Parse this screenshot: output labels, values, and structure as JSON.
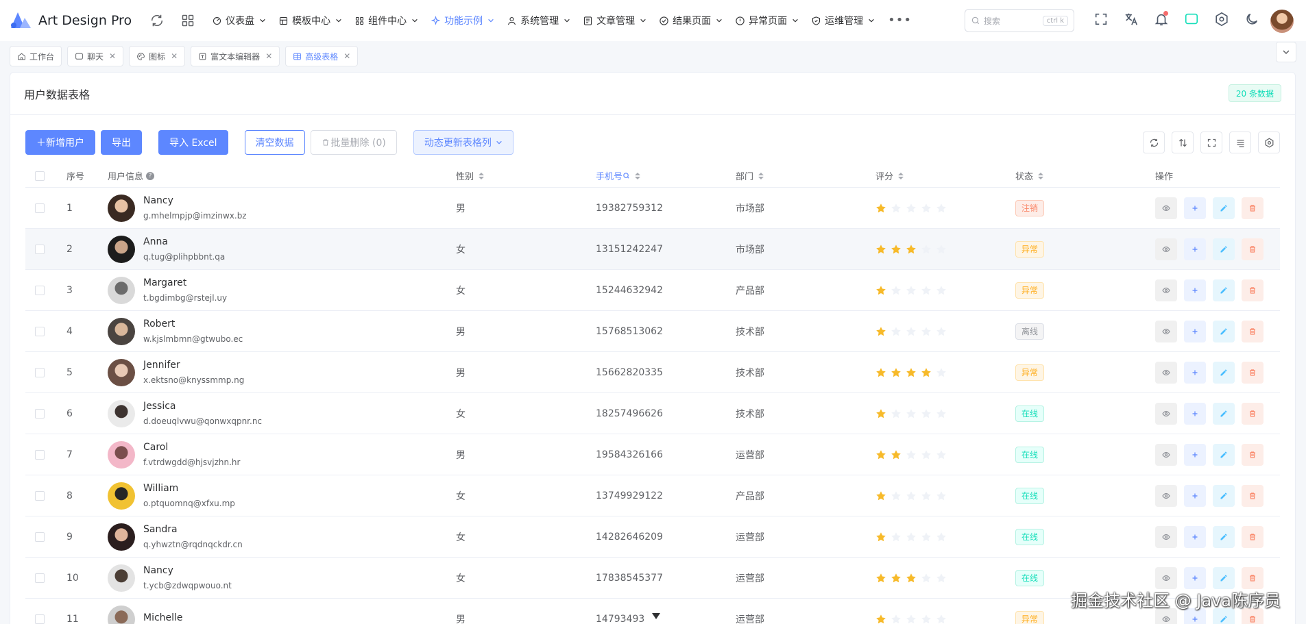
{
  "app": {
    "name": "Art Design Pro"
  },
  "menu": [
    {
      "label": "仪表盘",
      "icon": "dashboard-icon",
      "active": false
    },
    {
      "label": "模板中心",
      "icon": "template-icon",
      "active": false
    },
    {
      "label": "组件中心",
      "icon": "widgets-icon",
      "active": false
    },
    {
      "label": "功能示例",
      "icon": "sparkle-icon",
      "active": true
    },
    {
      "label": "系统管理",
      "icon": "user-icon",
      "active": false
    },
    {
      "label": "文章管理",
      "icon": "article-icon",
      "active": false
    },
    {
      "label": "结果页面",
      "icon": "check-circle-icon",
      "active": false
    },
    {
      "label": "异常页面",
      "icon": "warning-circle-icon",
      "active": false
    },
    {
      "label": "运维管理",
      "icon": "shield-icon",
      "active": false
    }
  ],
  "search": {
    "placeholder": "搜索",
    "shortcut": "ctrl k"
  },
  "tabs": [
    {
      "label": "工作台",
      "icon": "home-icon",
      "closable": false,
      "active": false
    },
    {
      "label": "聊天",
      "icon": "chat-icon",
      "closable": true,
      "active": false
    },
    {
      "label": "图标",
      "icon": "palette-icon",
      "closable": true,
      "active": false
    },
    {
      "label": "富文本编辑器",
      "icon": "editor-icon",
      "closable": true,
      "active": false
    },
    {
      "label": "高级表格",
      "icon": "table-icon",
      "closable": true,
      "active": true
    }
  ],
  "card": {
    "title": "用户数据表格",
    "count_badge": "20 条数据"
  },
  "toolbar": {
    "add_user": "＋新增用户",
    "export": "导出",
    "import_excel": "导入 Excel",
    "clear_data": "清空数据",
    "batch_delete": "批量删除 (0)",
    "dynamic_columns": "动态更新表格列"
  },
  "table": {
    "headers": {
      "index": "序号",
      "user": "用户信息",
      "gender": "性别",
      "phone": "手机号",
      "dept": "部门",
      "score": "评分",
      "status": "状态",
      "ops": "操作"
    },
    "rows": [
      {
        "idx": "1",
        "name": "Nancy",
        "email": "g.mhelmpjp@imzinwx.bz",
        "gender": "男",
        "phone": "19382759312",
        "dept": "市场部",
        "stars": 1,
        "status": "注销",
        "status_kind": "danger"
      },
      {
        "idx": "2",
        "name": "Anna",
        "email": "q.tug@plihpbbnt.qa",
        "gender": "女",
        "phone": "13151242247",
        "dept": "市场部",
        "stars": 3,
        "status": "异常",
        "status_kind": "warning"
      },
      {
        "idx": "3",
        "name": "Margaret",
        "email": "t.bgdimbg@rstejl.uy",
        "gender": "女",
        "phone": "15244632942",
        "dept": "产品部",
        "stars": 1,
        "status": "异常",
        "status_kind": "warning"
      },
      {
        "idx": "4",
        "name": "Robert",
        "email": "w.kjslmbmn@gtwubo.ec",
        "gender": "男",
        "phone": "15768513062",
        "dept": "技术部",
        "stars": 1,
        "status": "离线",
        "status_kind": "info"
      },
      {
        "idx": "5",
        "name": "Jennifer",
        "email": "x.ektsno@knyssmmp.ng",
        "gender": "男",
        "phone": "15662820335",
        "dept": "技术部",
        "stars": 4,
        "status": "异常",
        "status_kind": "warning"
      },
      {
        "idx": "6",
        "name": "Jessica",
        "email": "d.doeuqlvwu@qonwxqpnr.nc",
        "gender": "女",
        "phone": "18257496626",
        "dept": "技术部",
        "stars": 1,
        "status": "在线",
        "status_kind": "success"
      },
      {
        "idx": "7",
        "name": "Carol",
        "email": "f.vtrdwgdd@hjsvjzhn.hr",
        "gender": "男",
        "phone": "19584326166",
        "dept": "运营部",
        "stars": 2,
        "status": "在线",
        "status_kind": "success"
      },
      {
        "idx": "8",
        "name": "William",
        "email": "o.ptquomnq@xfxu.mp",
        "gender": "女",
        "phone": "13749929122",
        "dept": "产品部",
        "stars": 1,
        "status": "在线",
        "status_kind": "success"
      },
      {
        "idx": "9",
        "name": "Sandra",
        "email": "q.yhwztn@rqdnqckdr.cn",
        "gender": "女",
        "phone": "14282646209",
        "dept": "运营部",
        "stars": 1,
        "status": "在线",
        "status_kind": "success"
      },
      {
        "idx": "10",
        "name": "Nancy",
        "email": "t.ycb@zdwqpwouo.nt",
        "gender": "女",
        "phone": "17838545377",
        "dept": "运营部",
        "stars": 3,
        "status": "在线",
        "status_kind": "success"
      },
      {
        "idx": "11",
        "name": "Michelle",
        "email": "",
        "gender": "男",
        "phone": "14793493",
        "dept": "运营部",
        "stars": 1,
        "status": "异常",
        "status_kind": "warning"
      }
    ]
  },
  "colors": {
    "primary": "#5d87ff",
    "success": "#13deb9",
    "warning": "#ffae1f",
    "danger": "#fa896b",
    "info": "#909399",
    "star_on": "#f7ba2a",
    "star_off": "#eff2f7"
  },
  "watermark": "掘金技术社区 @ Java陈序员"
}
